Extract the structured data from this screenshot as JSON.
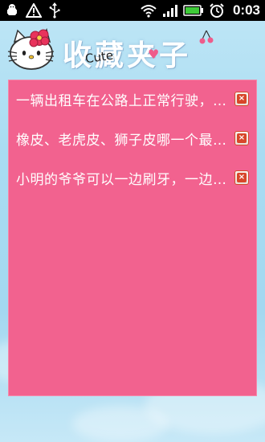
{
  "status_bar": {
    "time": "0:03",
    "left_icons": [
      "android-debug-icon",
      "warning-icon",
      "usb-icon"
    ],
    "right_icons": [
      "wifi-icon",
      "signal-icon",
      "battery-icon",
      "alarm-icon"
    ]
  },
  "header": {
    "title": "收藏夹子",
    "subtitle": "Cute",
    "logo": "hello-kitty-logo"
  },
  "favorites": {
    "items": [
      {
        "text": "一辆出租车在公路上正常行驶，没有违反交通规则"
      },
      {
        "text": "橡皮、老虎皮、狮子皮哪一个最不好"
      },
      {
        "text": "小明的爷爷可以一边刷牙，一边吹口哨"
      }
    ],
    "delete_icon": "delete-icon"
  },
  "colors": {
    "panel": "#f2628f",
    "background": "#a9dcf2",
    "delete": "#d8462a"
  }
}
